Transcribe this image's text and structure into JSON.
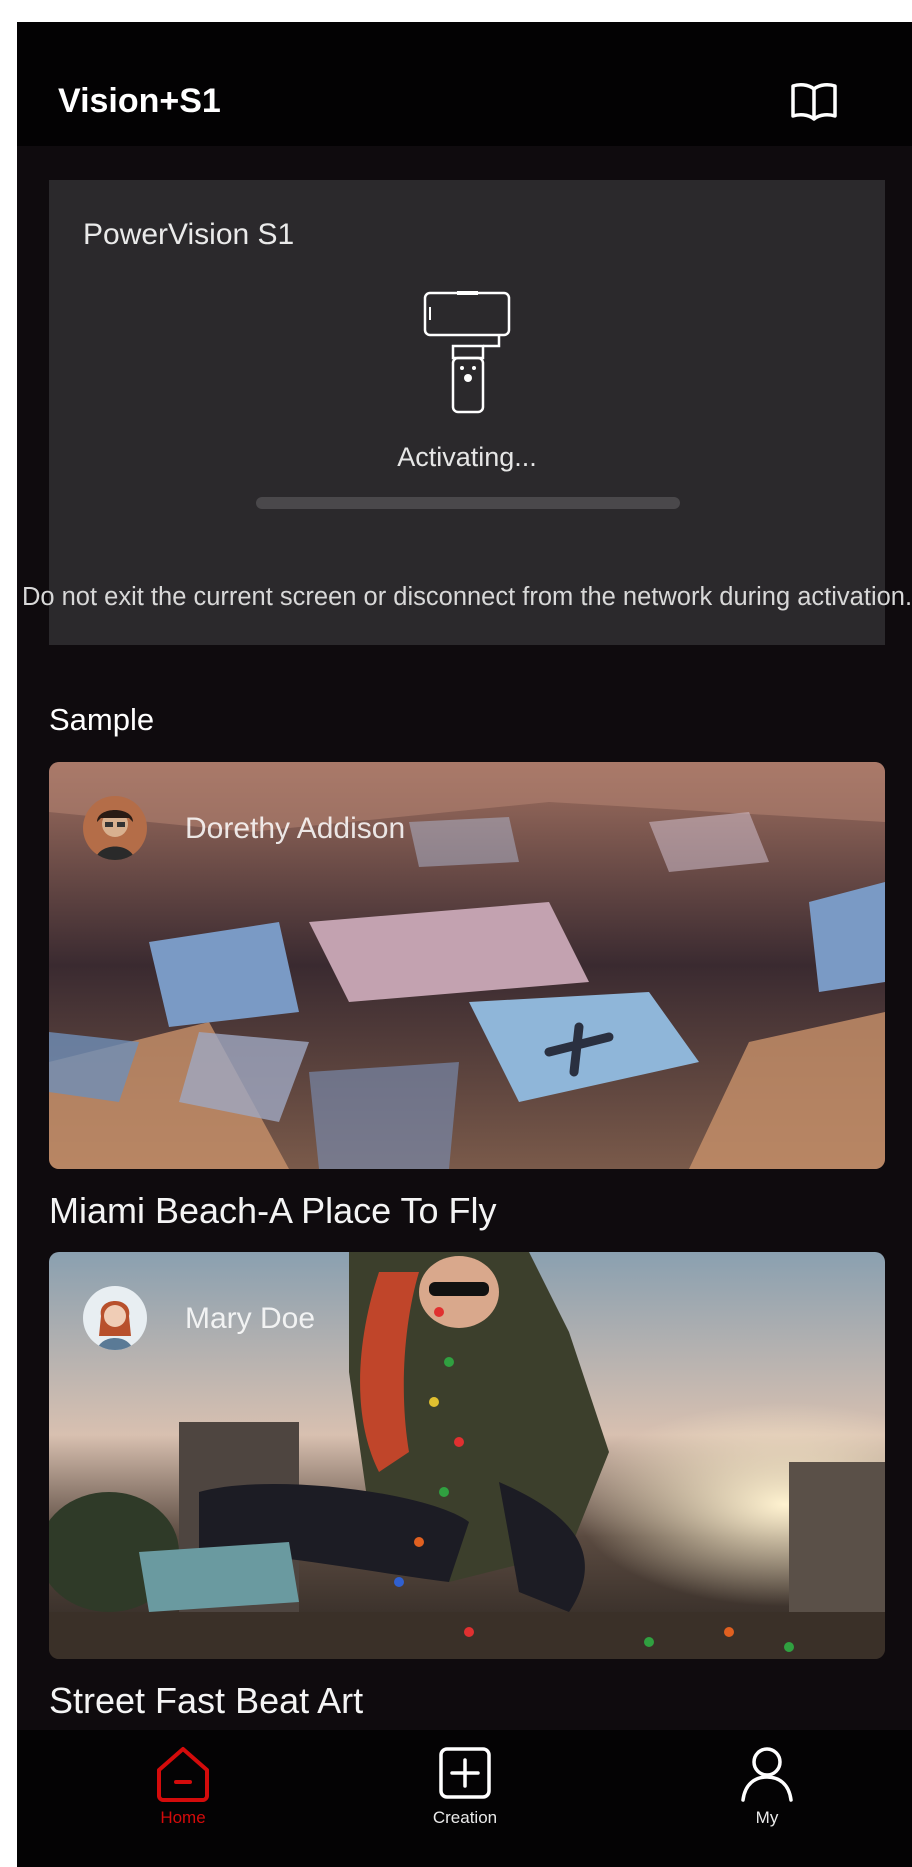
{
  "header": {
    "title": "Vision+S1",
    "guide_icon": "book-open-icon"
  },
  "activation": {
    "device_name": "PowerVision S1",
    "device_icon": "gimbal-icon",
    "status": "Activating...",
    "progress": 0,
    "warning": "Do not exit the current screen or disconnect from the network during activation."
  },
  "samples": {
    "section_title": "Sample",
    "items": [
      {
        "author": "Dorethy Addison",
        "title": "Miami Beach-A Place To Fly"
      },
      {
        "author": "Mary Doe",
        "title": "Street Fast Beat Art"
      }
    ]
  },
  "tabs": [
    {
      "label": "Home",
      "icon": "home-icon",
      "active": true
    },
    {
      "label": "Creation",
      "icon": "plus-square-icon",
      "active": false
    },
    {
      "label": "My",
      "icon": "user-icon",
      "active": false
    }
  ],
  "colors": {
    "accent": "#d40b0b",
    "background": "#0f0b0e",
    "card": "#2b292c"
  }
}
